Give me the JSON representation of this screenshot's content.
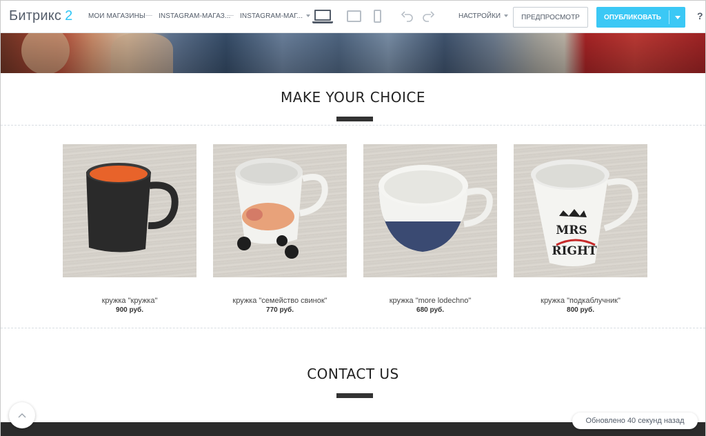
{
  "app": {
    "logo_text": "Битрикс",
    "logo_num": "2"
  },
  "breadcrumbs": [
    {
      "label": "Мои магазины"
    },
    {
      "label": "Instagram-магаз..."
    },
    {
      "label": "Instagram-маг..."
    }
  ],
  "toolbar": {
    "settings_label": "Настройки",
    "preview_label": "Предпросмотр",
    "publish_label": "Опубликовать",
    "help_label": "?"
  },
  "sections": {
    "choice_title": "MAKE YOUR CHOICE",
    "contact_title": "CONTACT US"
  },
  "products": [
    {
      "name": "кружка \"кружка\"",
      "price": "900 руб."
    },
    {
      "name": "кружка \"семейство свинок\"",
      "price": "770 руб."
    },
    {
      "name": "кружка \"more lodechno\"",
      "price": "680 руб."
    },
    {
      "name": "кружка \"подкаблучник\"",
      "price": "800 руб."
    }
  ],
  "status": {
    "updated": "Обновлено 40 секунд назад"
  },
  "colors": {
    "accent": "#3bc8f5",
    "logo_num": "#2fc6f6",
    "text": "#535c69"
  }
}
